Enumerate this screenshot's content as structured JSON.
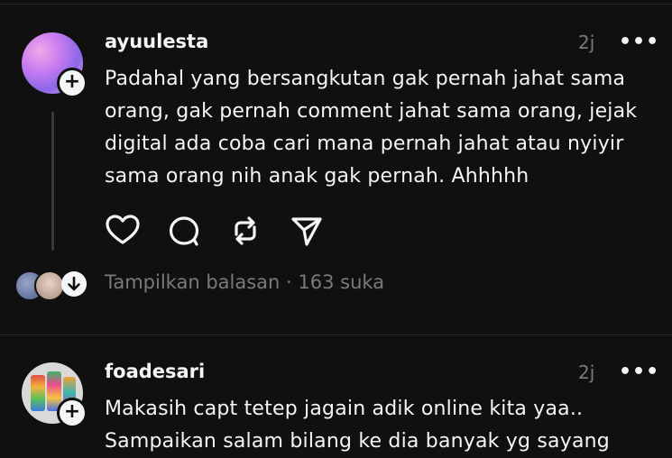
{
  "posts": [
    {
      "username": "ayuulesta",
      "time": "2j",
      "more": "•••",
      "text_lines": [
        "Padahal yang bersangkutan gak pernah jahat sama",
        "orang, gak pernah comment jahat sama orang, jejak",
        "digital ada coba cari mana pernah jahat atau nyiyir",
        "sama orang nih anak gak pernah. Ahhhhh"
      ],
      "replies_label": "Tampilkan balasan",
      "separator": "·",
      "likes": "163 suka"
    },
    {
      "username": "foadesari",
      "time": "2j",
      "more": "•••",
      "text_lines": [
        "Makasih capt tetep jagain adik online kita yaa..",
        "Sampaikan salam bilang ke dia banyak yg sayang"
      ]
    }
  ],
  "icons": {
    "follow": "plus-icon",
    "like": "heart-icon",
    "comment": "comment-icon",
    "repost": "repost-icon",
    "share": "send-icon",
    "expand": "arrow-down-icon"
  },
  "colors": {
    "background": "#101010",
    "text": "#f3f5f7",
    "secondary": "#7a7a7a"
  }
}
